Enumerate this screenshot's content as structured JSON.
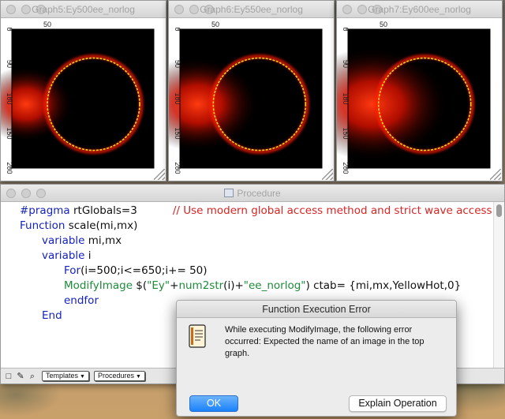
{
  "windows": {
    "graph5": {
      "title": "Graph5:Ey500ee_norlog"
    },
    "graph6": {
      "title": "Graph6:Ey550ee_norlog"
    },
    "graph7": {
      "title": "Graph7:Ey600ee_norlog"
    },
    "procedure": {
      "title": "Procedure"
    }
  },
  "graph_axes": {
    "ticks": [
      "0",
      "50",
      "100",
      "150",
      "200"
    ],
    "top_tick": "50",
    "range": [
      0,
      200
    ]
  },
  "code": {
    "line1": {
      "kw": "#pragma",
      "rest": " rtGlobals=3",
      "comment": "// Use modern global access method and strict wave access."
    },
    "line2": {
      "kw": "Function",
      "rest": " scale(mi,mx)"
    },
    "line3": {
      "kw": "variable",
      "rest": " mi,mx"
    },
    "line4": {
      "kw": "variable",
      "rest": " i"
    },
    "line5": {
      "kw": "For",
      "rest": "(i=500;i<=650;i+= 50)"
    },
    "line6": {
      "fn": "ModifyImage",
      "a": " $(",
      "s1": "\"Ey\"",
      "b": "+",
      "fn2": "num2str",
      "c": "(i)+",
      "s2": "\"ee_norlog\"",
      "d": ") ctab= {mi,mx,YellowHot,0}"
    },
    "line7": {
      "kw": "endfor"
    },
    "line8": {
      "kw": "End"
    }
  },
  "statusbar": {
    "templates": "Templates",
    "procedures": "Procedures"
  },
  "dialog": {
    "title": "Function Execution Error",
    "message": "While executing ModifyImage, the following error occurred:  Expected the name of an image in the top graph.",
    "ok": "OK",
    "explain": "Explain Operation"
  },
  "images": [
    {
      "name": "Ey500ee_norlog",
      "colormap": "YellowHot",
      "ring_center": [
        115,
        108
      ],
      "ring_radius": 65,
      "glow_center": [
        20,
        108
      ]
    },
    {
      "name": "Ey550ee_norlog",
      "colormap": "YellowHot",
      "ring_center": [
        112,
        108
      ],
      "ring_radius": 65,
      "glow_center": [
        25,
        108
      ]
    },
    {
      "name": "Ey600ee_norlog",
      "colormap": "YellowHot",
      "ring_center": [
        108,
        108
      ],
      "ring_radius": 65,
      "glow_center": [
        35,
        108
      ]
    }
  ],
  "colors": {
    "hot_red": "#ff1a00",
    "hot_yellow": "#ffd21a",
    "ok_blue": "#1a82fb"
  }
}
